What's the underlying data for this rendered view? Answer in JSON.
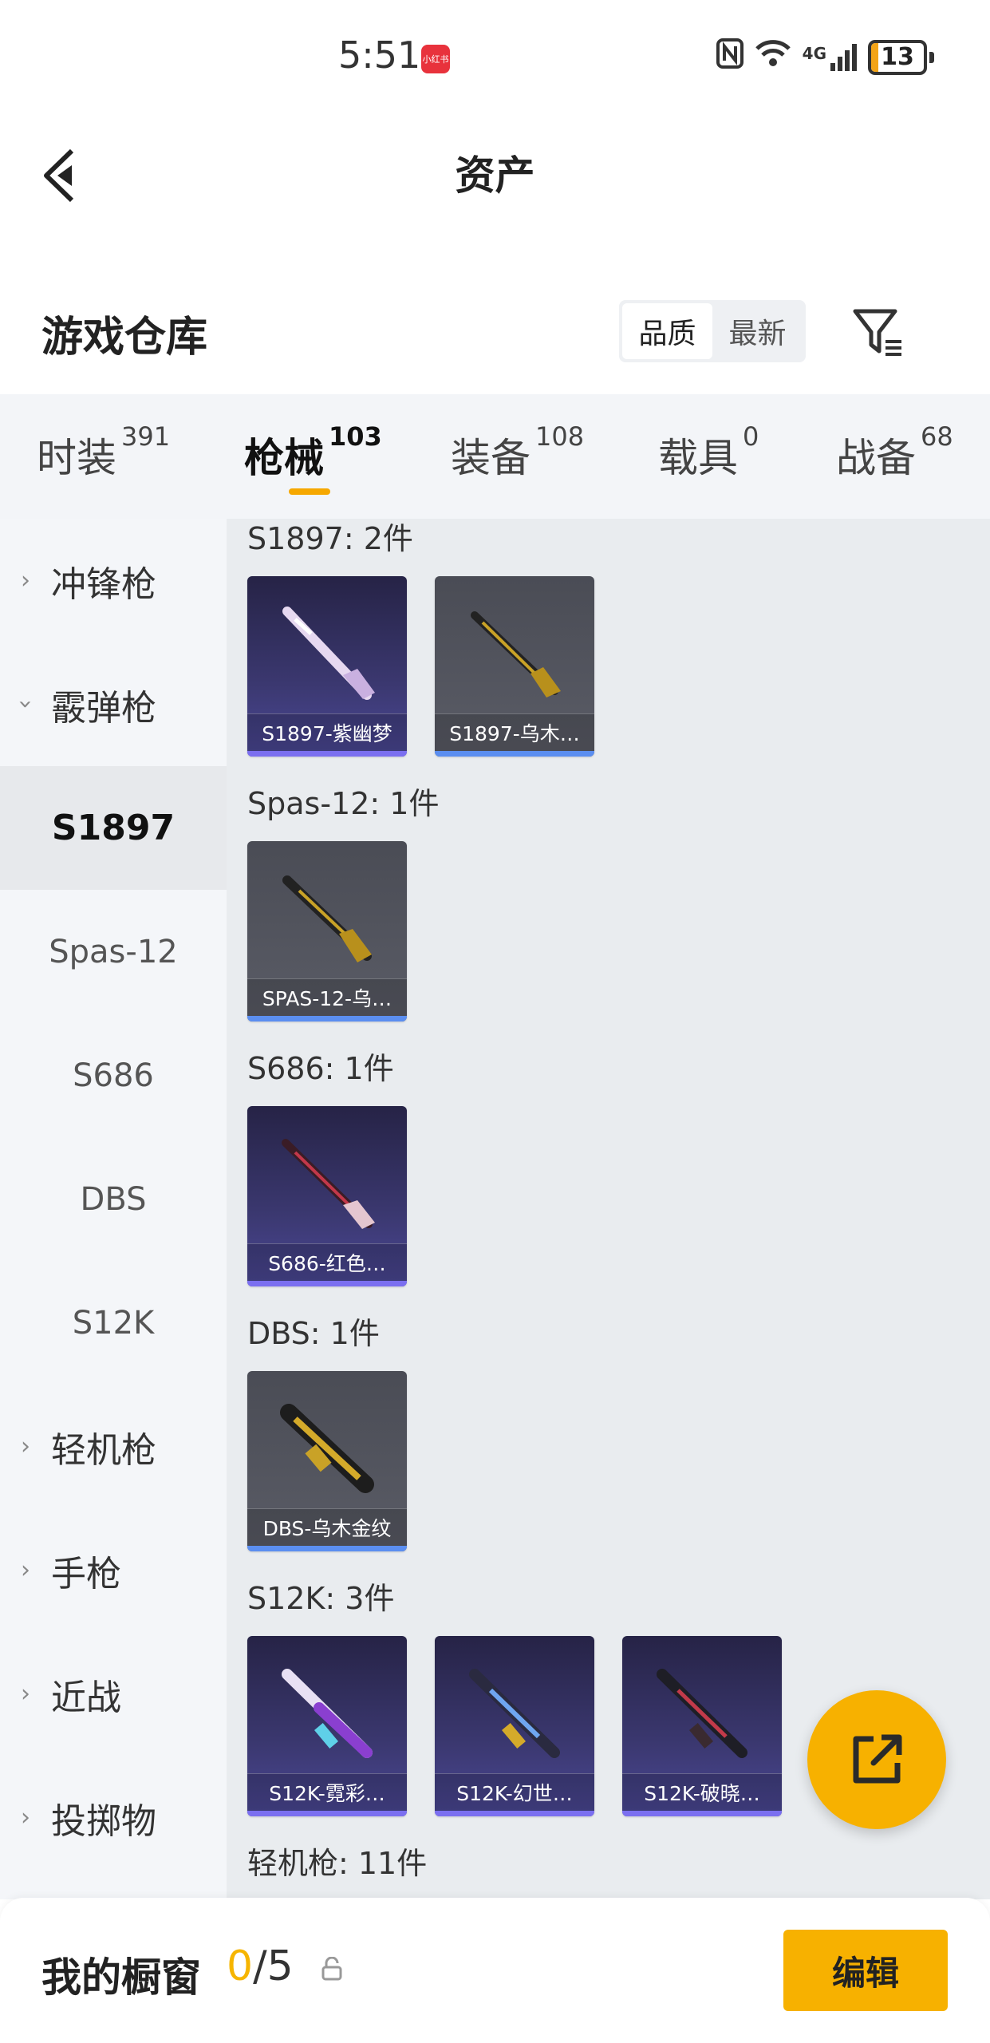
{
  "status_bar": {
    "time": "5:51",
    "app_badge": "小红书",
    "network": "4G",
    "battery": "13",
    "battery_level": 0.13
  },
  "header": {
    "title": "资产"
  },
  "warehouse": {
    "title": "游戏仓库",
    "sort_options": [
      "品质",
      "最新"
    ],
    "sort_selected": "品质"
  },
  "tabs": [
    {
      "label": "时装",
      "count": "391"
    },
    {
      "label": "枪械",
      "count": "103"
    },
    {
      "label": "装备",
      "count": "108"
    },
    {
      "label": "载具",
      "count": "0"
    },
    {
      "label": "战备",
      "count": "68"
    }
  ],
  "sidebar": {
    "categories": [
      "冲锋枪",
      "霰弹枪",
      "轻机枪",
      "手枪",
      "近战",
      "投掷物"
    ],
    "subitems": [
      "S1897",
      "Spas-12",
      "S686",
      "DBS",
      "S12K"
    ],
    "active_sub": "S1897"
  },
  "groups": [
    {
      "label": "S1897: 2件",
      "items": [
        {
          "name": "S1897-紫幽梦",
          "quality": "purple"
        },
        {
          "name": "S1897-乌木…",
          "quality": "gray"
        }
      ]
    },
    {
      "label": "Spas-12: 1件",
      "items": [
        {
          "name": "SPAS-12-乌…",
          "quality": "gray"
        }
      ]
    },
    {
      "label": "S686: 1件",
      "items": [
        {
          "name": "S686-红色…",
          "quality": "purple"
        }
      ]
    },
    {
      "label": "DBS: 1件",
      "items": [
        {
          "name": "DBS-乌木金纹",
          "quality": "gray"
        }
      ]
    },
    {
      "label": "S12K: 3件",
      "items": [
        {
          "name": "S12K-霓彩…",
          "quality": "purple"
        },
        {
          "name": "S12K-幻世…",
          "quality": "purple"
        },
        {
          "name": "S12K-破晓…",
          "quality": "purple"
        }
      ]
    },
    {
      "label": "轻机枪: 11件",
      "items": []
    }
  ],
  "bottom_bar": {
    "label": "我的橱窗",
    "count": "0",
    "separator": "/",
    "total": "5",
    "edit_label": "编辑"
  },
  "colors": {
    "accent": "#f7b100",
    "purple_quality": "#7b6ff0",
    "gray_quality": "#5b8ef0"
  }
}
